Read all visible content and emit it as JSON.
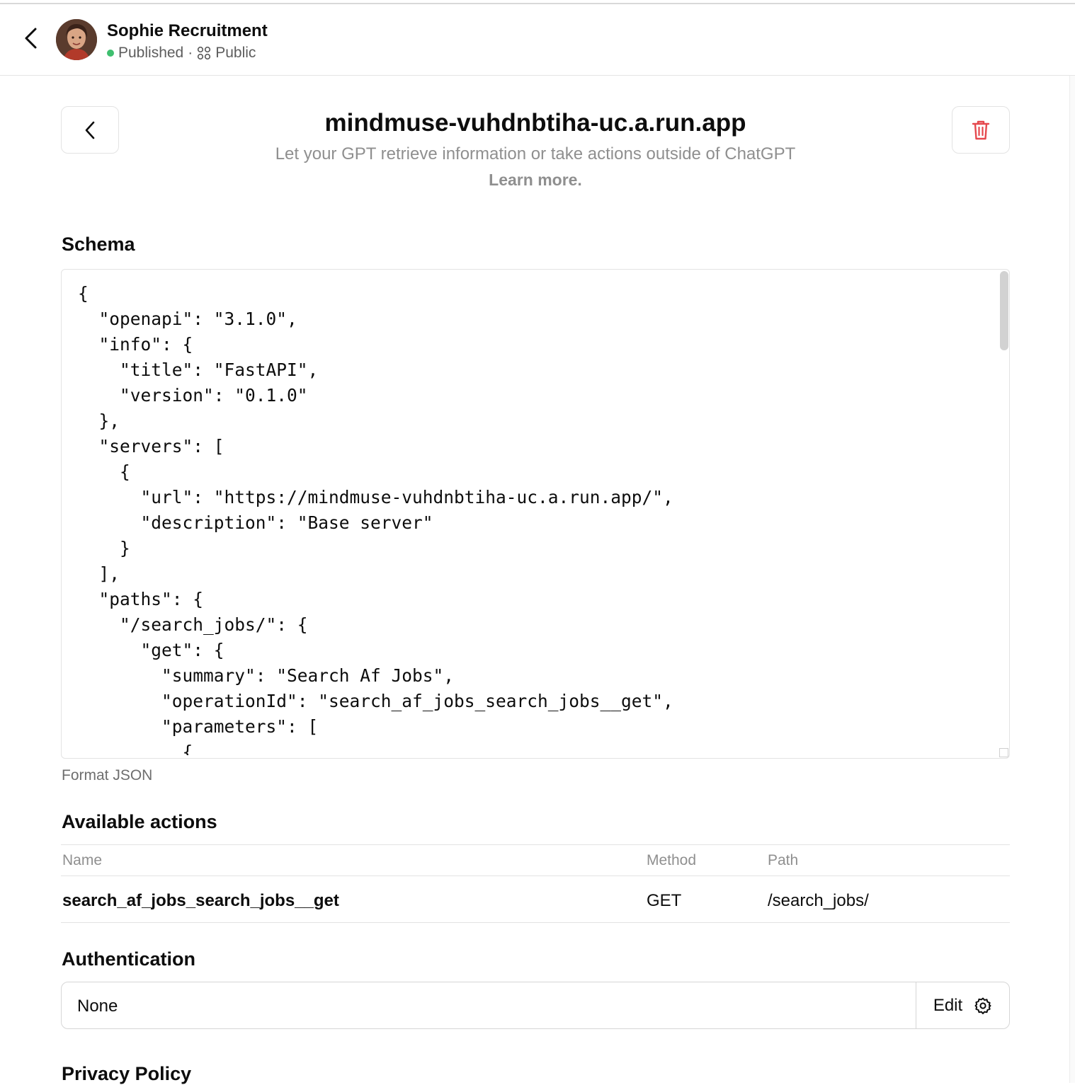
{
  "header": {
    "gpt_name": "Sophie Recruitment",
    "status": "Published",
    "separator": "·",
    "visibility": "Public"
  },
  "action": {
    "title": "mindmuse-vuhdnbtiha-uc.a.run.app",
    "subtitle": "Let your GPT retrieve information or take actions outside of ChatGPT",
    "learn_more": "Learn more."
  },
  "schema": {
    "label": "Schema",
    "code": "{\n  \"openapi\": \"3.1.0\",\n  \"info\": {\n    \"title\": \"FastAPI\",\n    \"version\": \"0.1.0\"\n  },\n  \"servers\": [\n    {\n      \"url\": \"https://mindmuse-vuhdnbtiha-uc.a.run.app/\",\n      \"description\": \"Base server\"\n    }\n  ],\n  \"paths\": {\n    \"/search_jobs/\": {\n      \"get\": {\n        \"summary\": \"Search Af Jobs\",\n        \"operationId\": \"search_af_jobs_search_jobs__get\",\n        \"parameters\": [\n          {",
    "format_label": "Format JSON"
  },
  "available_actions": {
    "label": "Available actions",
    "columns": [
      "Name",
      "Method",
      "Path"
    ],
    "rows": [
      {
        "name": "search_af_jobs_search_jobs__get",
        "method": "GET",
        "path": "/search_jobs/"
      }
    ]
  },
  "authentication": {
    "label": "Authentication",
    "value": "None",
    "edit_label": "Edit"
  },
  "privacy": {
    "label": "Privacy Policy"
  },
  "colors": {
    "status_green": "#3fbf6f",
    "delete_red": "#e5484d",
    "muted_text": "#8f8f8f"
  },
  "icons": {
    "back": "chevron-left-icon",
    "delete": "trash-icon",
    "visibility": "grid-icon",
    "settings": "gear-icon"
  }
}
